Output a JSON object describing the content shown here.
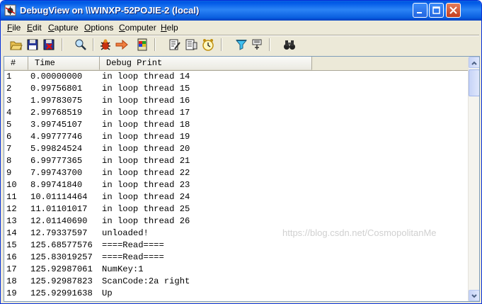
{
  "window": {
    "title": "DebugView on \\\\WINXP-52POJIE-2 (local)"
  },
  "menu": [
    {
      "acc": "F",
      "rest": "ile"
    },
    {
      "acc": "E",
      "rest": "dit"
    },
    {
      "acc": "C",
      "rest": "apture"
    },
    {
      "acc": "O",
      "rest": "ptions"
    },
    {
      "acc": "C",
      "rest": "omputer"
    },
    {
      "acc": "H",
      "rest": "elp"
    }
  ],
  "toolbar_icons": [
    "open-icon",
    "save-icon",
    "clear-icon",
    "find-icon",
    "capture-icon",
    "autoscroll-icon",
    "capture-kernel-icon",
    "filter-icon",
    "highlight-icon",
    "clock-icon",
    "history-icon",
    "pin-icon",
    "binoculars-icon"
  ],
  "columns": {
    "idx": "#",
    "time": "Time",
    "msg": "Debug Print"
  },
  "rows": [
    {
      "idx": "1",
      "time": "0.00000000",
      "msg": "in loop thread 14"
    },
    {
      "idx": "2",
      "time": "0.99756801",
      "msg": "in loop thread 15"
    },
    {
      "idx": "3",
      "time": "1.99783075",
      "msg": "in loop thread 16"
    },
    {
      "idx": "4",
      "time": "2.99768519",
      "msg": "in loop thread 17"
    },
    {
      "idx": "5",
      "time": "3.99745107",
      "msg": "in loop thread 18"
    },
    {
      "idx": "6",
      "time": "4.99777746",
      "msg": "in loop thread 19"
    },
    {
      "idx": "7",
      "time": "5.99824524",
      "msg": "in loop thread 20"
    },
    {
      "idx": "8",
      "time": "6.99777365",
      "msg": "in loop thread 21"
    },
    {
      "idx": "9",
      "time": "7.99743700",
      "msg": "in loop thread 22"
    },
    {
      "idx": "10",
      "time": "8.99741840",
      "msg": "in loop thread 23"
    },
    {
      "idx": "11",
      "time": "10.01114464",
      "msg": "in loop thread 24"
    },
    {
      "idx": "12",
      "time": "11.01101017",
      "msg": "in loop thread 25"
    },
    {
      "idx": "13",
      "time": "12.01140690",
      "msg": "in loop thread 26"
    },
    {
      "idx": "14",
      "time": "12.79337597",
      "msg": "unloaded!"
    },
    {
      "idx": "15",
      "time": "125.68577576",
      "msg": "====Read===="
    },
    {
      "idx": "16",
      "time": "125.83019257",
      "msg": "====Read===="
    },
    {
      "idx": "17",
      "time": "125.92987061",
      "msg": "NumKey:1"
    },
    {
      "idx": "18",
      "time": "125.92987823",
      "msg": "ScanCode:2a right"
    },
    {
      "idx": "19",
      "time": "125.92991638",
      "msg": "Up"
    }
  ],
  "watermark": "https://blog.csdn.net/CosmopolitanMe"
}
